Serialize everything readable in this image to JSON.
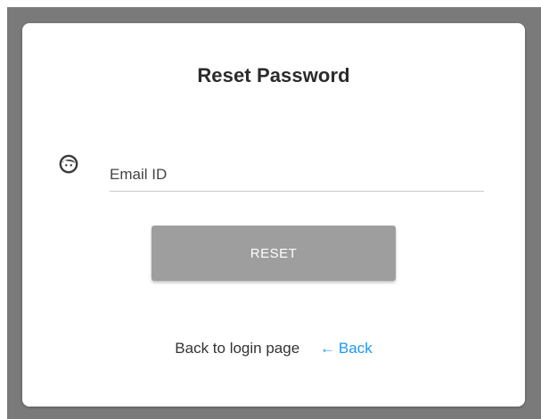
{
  "title": "Reset Password",
  "email": {
    "placeholder": "Email ID",
    "value": "",
    "icon": "face-icon"
  },
  "reset_button": {
    "label": "RESET",
    "color": "#9e9e9e"
  },
  "footer": {
    "text": "Back to login page",
    "back_arrow": "←",
    "back_label": "Back",
    "link_color": "#2196f3"
  },
  "colors": {
    "backdrop": "#7a7a7a",
    "card": "#ffffff"
  }
}
